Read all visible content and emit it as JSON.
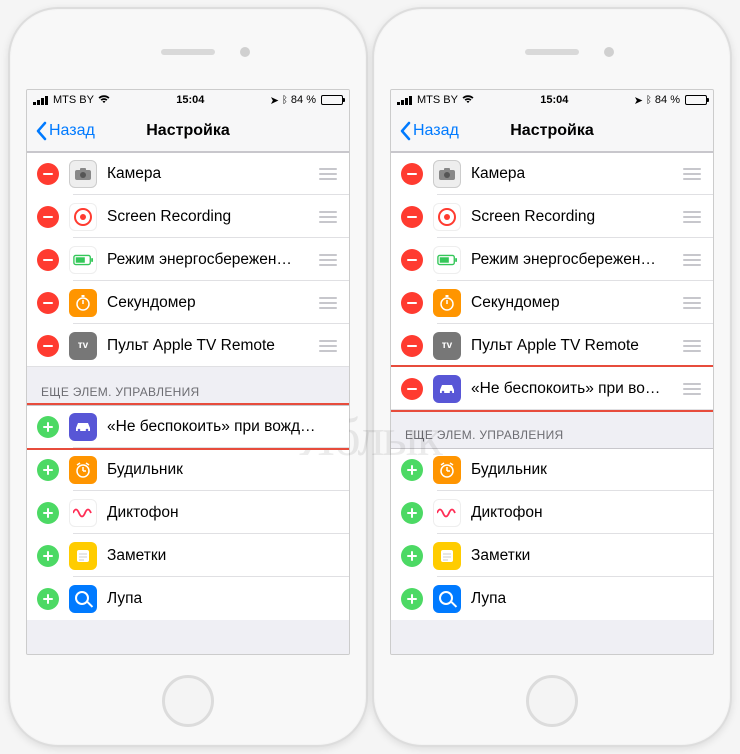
{
  "status": {
    "carrier": "MTS BY",
    "time": "15:04",
    "battery_text": "84 %",
    "wifi": "᯾"
  },
  "nav": {
    "back_label": "Назад",
    "title": "Настройка"
  },
  "sections": {
    "included_header": "",
    "more_header": "ЕЩЕ ЭЛЕМ. УПРАВЛЕНИЯ"
  },
  "items": {
    "camera": "Камера",
    "screen_recording": "Screen Recording",
    "low_power": "Режим энергосбережен…",
    "stopwatch": "Секундомер",
    "apple_tv": "Пульт Apple TV Remote",
    "dnd_driving_left": "«Не беспокоить» при вожд…",
    "dnd_driving_right": "«Не беспокоить» при во…",
    "alarm": "Будильник",
    "voice_memo": "Диктофон",
    "notes": "Заметки",
    "magnifier": "Лупа",
    "appletv_text": "ᴛᴠ"
  },
  "watermark": "Яблык"
}
